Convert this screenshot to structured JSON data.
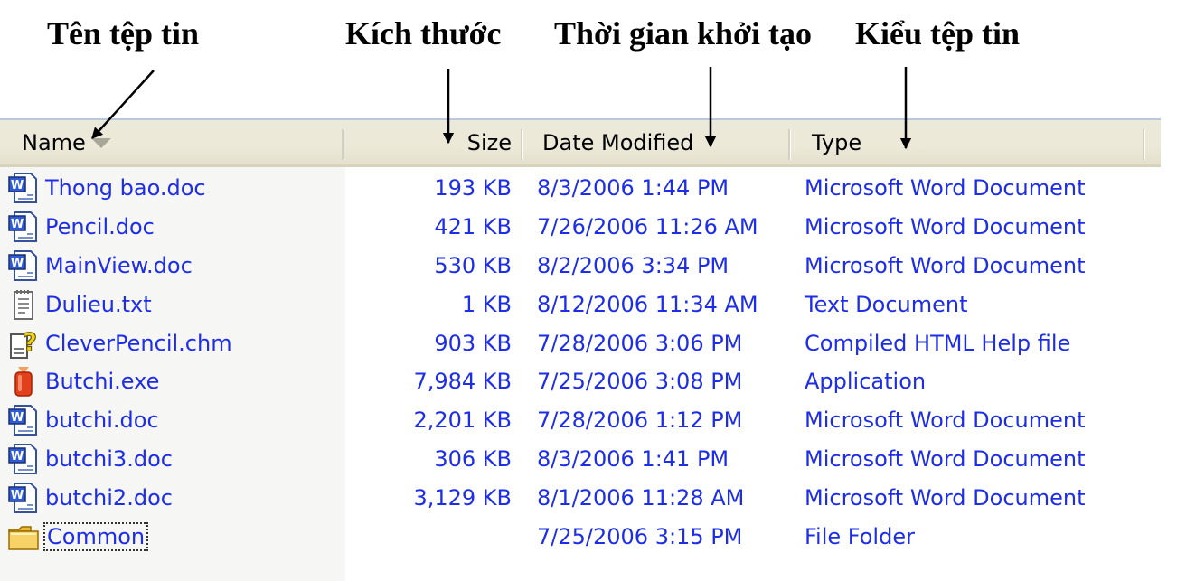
{
  "annotations": {
    "name": "Tên tệp tin",
    "size": "Kích thước",
    "date": "Thời gian khởi tạo",
    "type": "Kiểu tệp tin"
  },
  "columns": {
    "name": "Name",
    "size": "Size",
    "date": "Date Modified",
    "type": "Type"
  },
  "sort": {
    "column": "name",
    "direction": "descending"
  },
  "files": [
    {
      "name": "Thong bao.doc",
      "size": "193 KB",
      "date": "8/3/2006 1:44 PM",
      "type": "Microsoft Word Document",
      "icon": "word-document-icon"
    },
    {
      "name": "Pencil.doc",
      "size": "421 KB",
      "date": "7/26/2006 11:26 AM",
      "type": "Microsoft Word Document",
      "icon": "word-document-icon"
    },
    {
      "name": "MainView.doc",
      "size": "530 KB",
      "date": "8/2/2006 3:34 PM",
      "type": "Microsoft Word Document",
      "icon": "word-document-icon"
    },
    {
      "name": "Dulieu.txt",
      "size": "1 KB",
      "date": "8/12/2006 11:34 AM",
      "type": "Text Document",
      "icon": "text-document-icon"
    },
    {
      "name": "CleverPencil.chm",
      "size": "903 KB",
      "date": "7/28/2006 3:06 PM",
      "type": "Compiled HTML Help file",
      "icon": "help-file-icon"
    },
    {
      "name": "Butchi.exe",
      "size": "7,984 KB",
      "date": "7/25/2006 3:08 PM",
      "type": "Application",
      "icon": "application-icon"
    },
    {
      "name": "butchi.doc",
      "size": "2,201 KB",
      "date": "7/28/2006 1:12 PM",
      "type": "Microsoft Word Document",
      "icon": "word-document-icon"
    },
    {
      "name": "butchi3.doc",
      "size": "306 KB",
      "date": "8/3/2006 1:41 PM",
      "type": "Microsoft Word Document",
      "icon": "word-document-icon"
    },
    {
      "name": "butchi2.doc",
      "size": "3,129 KB",
      "date": "8/1/2006 11:28 AM",
      "type": "Microsoft Word Document",
      "icon": "word-document-icon"
    },
    {
      "name": "Common",
      "size": "",
      "date": "7/25/2006 3:15 PM",
      "type": "File Folder",
      "icon": "folder-icon",
      "focused": true
    }
  ],
  "colors": {
    "link_text": "#1d2de8",
    "header_bg": "#ece9d8"
  }
}
